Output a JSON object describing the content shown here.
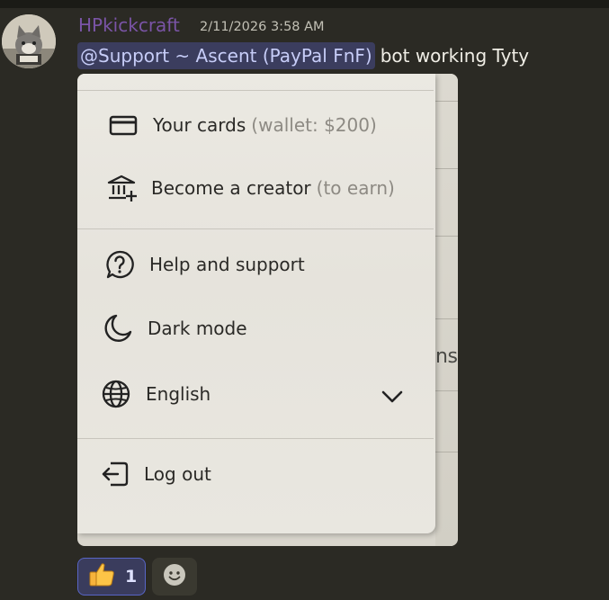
{
  "message": {
    "username": "HPkickcraft",
    "timestamp": "2/11/2026 3:58 AM",
    "mention": "@Support ~ Ascent (PayPal FnF)",
    "text": "bot working Tyty"
  },
  "attachment_menu": {
    "items": [
      {
        "label": "Your cards",
        "sub": "(wallet: $200)",
        "icon": "credit-card-icon"
      },
      {
        "label": "Become a creator",
        "sub": "(to earn)",
        "icon": "bank-icon"
      },
      {
        "label": "Help and support",
        "sub": "",
        "icon": "help-icon"
      },
      {
        "label": "Dark mode",
        "sub": "",
        "icon": "moon-icon"
      },
      {
        "label": "English",
        "sub": "",
        "icon": "globe-icon"
      },
      {
        "label": "Log out",
        "sub": "",
        "icon": "logout-icon"
      }
    ],
    "partial_text": "ns"
  },
  "reactions": {
    "thumbs_up_count": "1"
  },
  "colors": {
    "username": "#7a54a6",
    "mention_bg": "#3b3d5e",
    "reaction_border": "#5865c6"
  }
}
